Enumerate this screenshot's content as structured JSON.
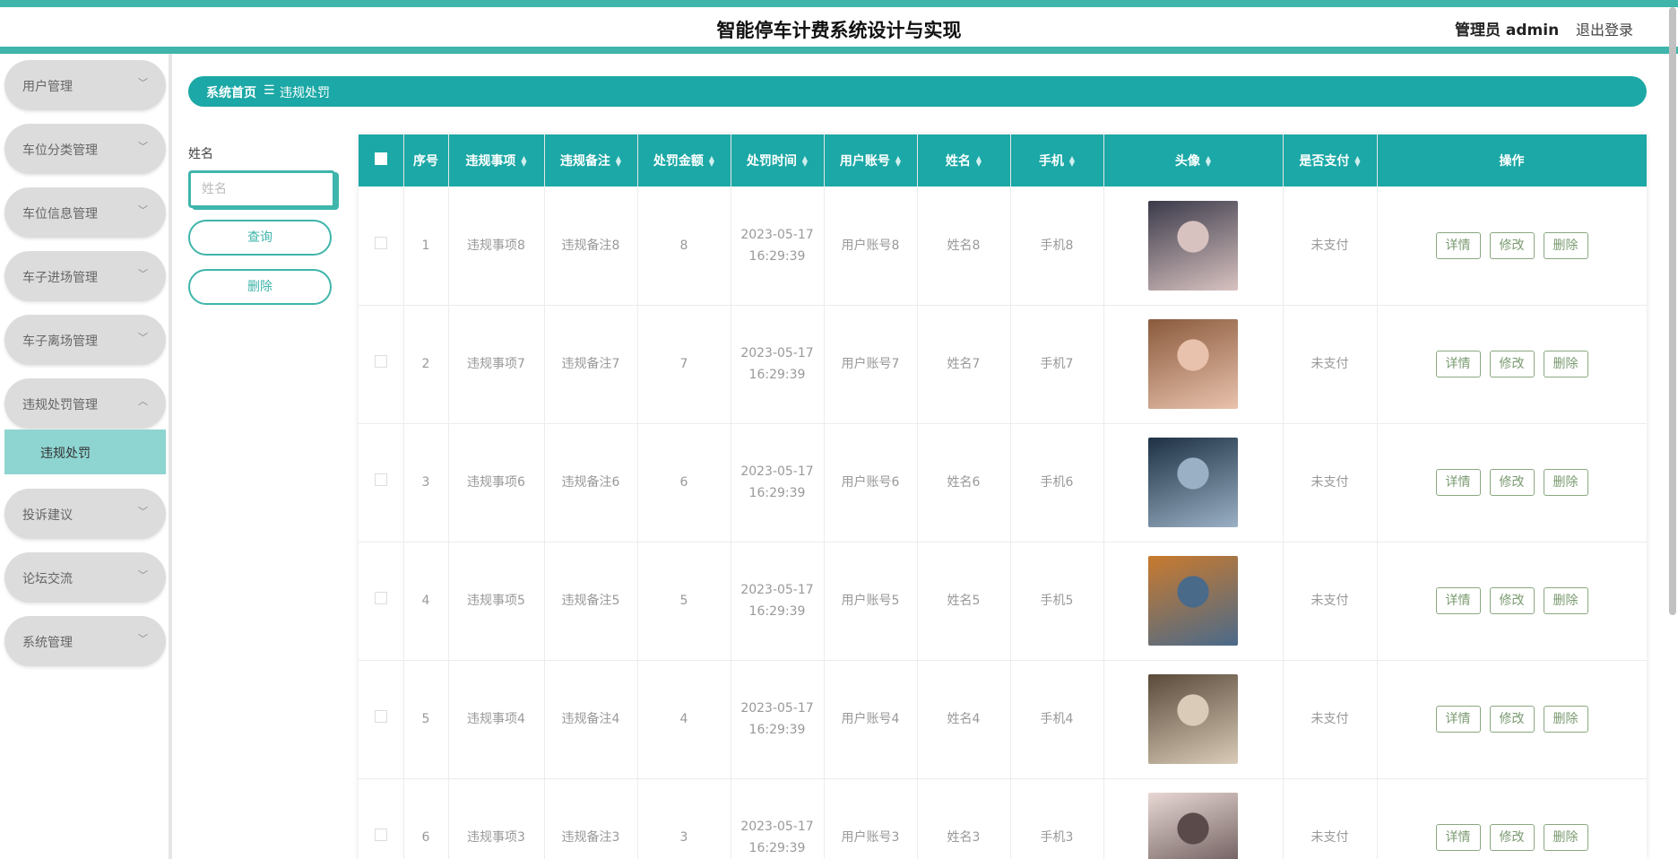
{
  "header": {
    "title": "智能停车计费系统设计与实现",
    "user": "管理员 admin",
    "logout": "退出登录"
  },
  "sidebar": {
    "items": [
      {
        "label": "用户管理",
        "chevron": "﹀"
      },
      {
        "label": "车位分类管理",
        "chevron": "﹀"
      },
      {
        "label": "车位信息管理",
        "chevron": "﹀"
      },
      {
        "label": "车子进场管理",
        "chevron": "﹀"
      },
      {
        "label": "车子离场管理",
        "chevron": "﹀"
      },
      {
        "label": "违规处罚管理",
        "chevron": "︿"
      },
      {
        "label": "投诉建议",
        "chevron": "﹀"
      },
      {
        "label": "论坛交流",
        "chevron": "﹀"
      },
      {
        "label": "系统管理",
        "chevron": "﹀"
      }
    ],
    "active_sub": "违规处罚"
  },
  "breadcrumb": {
    "home": "系统首页",
    "sep": "☰",
    "current": "违规处罚"
  },
  "search": {
    "label": "姓名",
    "placeholder": "姓名",
    "query_button": "查询",
    "delete_button": "删除"
  },
  "table": {
    "headers": [
      "序号",
      "违规事项",
      "违规备注",
      "处罚金额",
      "处罚时间",
      "用户账号",
      "姓名",
      "手机",
      "头像",
      "是否支付",
      "操作"
    ],
    "actions": {
      "detail": "详情",
      "edit": "修改",
      "delete": "删除"
    },
    "rows": [
      {
        "no": "1",
        "item": "违规事项8",
        "note": "违规备注8",
        "amount": "8",
        "date": "2023-05-17",
        "time": "16:29:39",
        "account": "用户账号8",
        "name": "姓名8",
        "phone": "手机8",
        "paid": "未支付",
        "avatar_colors": [
          "#3b3a4a",
          "#d8c2c0"
        ]
      },
      {
        "no": "2",
        "item": "违规事项7",
        "note": "违规备注7",
        "amount": "7",
        "date": "2023-05-17",
        "time": "16:29:39",
        "account": "用户账号7",
        "name": "姓名7",
        "phone": "手机7",
        "paid": "未支付",
        "avatar_colors": [
          "#8a5a3c",
          "#e9c2ad"
        ]
      },
      {
        "no": "3",
        "item": "违规事项6",
        "note": "违规备注6",
        "amount": "6",
        "date": "2023-05-17",
        "time": "16:29:39",
        "account": "用户账号6",
        "name": "姓名6",
        "phone": "手机6",
        "paid": "未支付",
        "avatar_colors": [
          "#1e3144",
          "#9ab0c4"
        ]
      },
      {
        "no": "4",
        "item": "违规事项5",
        "note": "违规备注5",
        "amount": "5",
        "date": "2023-05-17",
        "time": "16:29:39",
        "account": "用户账号5",
        "name": "姓名5",
        "phone": "手机5",
        "paid": "未支付",
        "avatar_colors": [
          "#c97a2e",
          "#4a6a8a"
        ]
      },
      {
        "no": "5",
        "item": "违规事项4",
        "note": "违规备注4",
        "amount": "4",
        "date": "2023-05-17",
        "time": "16:29:39",
        "account": "用户账号4",
        "name": "姓名4",
        "phone": "手机4",
        "paid": "未支付",
        "avatar_colors": [
          "#5a4a3a",
          "#d9cbb8"
        ]
      },
      {
        "no": "6",
        "item": "违规事项3",
        "note": "违规备注3",
        "amount": "3",
        "date": "2023-05-17",
        "time": "16:29:39",
        "account": "用户账号3",
        "name": "姓名3",
        "phone": "手机3",
        "paid": "未支付",
        "avatar_colors": [
          "#e8d8d4",
          "#5b4a4a"
        ]
      }
    ]
  },
  "colors": {
    "accent": "#1ba8a6",
    "accent_light": "#3fb5ab",
    "active_menu": "#8ed5d1",
    "menu_bg": "#dcdcdc"
  }
}
